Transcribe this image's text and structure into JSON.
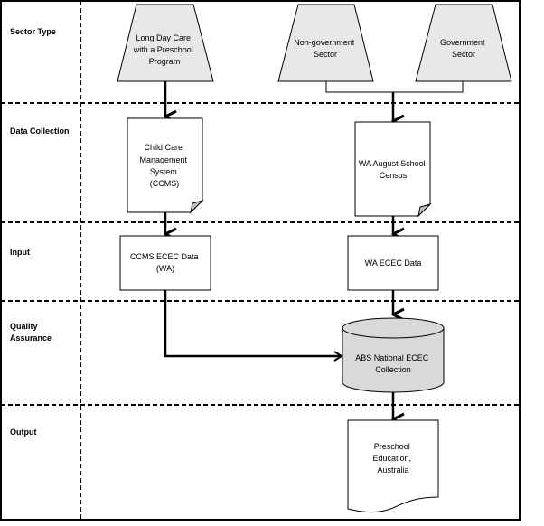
{
  "diagram": {
    "colors": {
      "shape_fill_gray": "#e8e8e8",
      "cylinder_fill": "#d9d9d9",
      "fold_fill": "#c0c0c0",
      "line": "#000000",
      "background": "#ffffff"
    },
    "lanes": [
      {
        "id": "sector-type",
        "label": [
          "Sector Type"
        ]
      },
      {
        "id": "data-collection",
        "label": [
          "Data Collection"
        ]
      },
      {
        "id": "input",
        "label": [
          "Input"
        ]
      },
      {
        "id": "quality-assurance",
        "label": [
          "Quality",
          "Assurance"
        ]
      },
      {
        "id": "output",
        "label": [
          "Output"
        ]
      }
    ],
    "nodes": {
      "long_day_care": {
        "shape": "trapezoid",
        "text": [
          "Long Day Care",
          "with a Preschool",
          "Program"
        ]
      },
      "non_government": {
        "shape": "trapezoid",
        "text": [
          "Non-government",
          "Sector"
        ]
      },
      "government": {
        "shape": "trapezoid",
        "text": [
          "Government",
          "Sector"
        ]
      },
      "ccms": {
        "shape": "document-folded",
        "text": [
          "Child Care",
          "Management",
          "System",
          "(CCMS)"
        ]
      },
      "wa_census": {
        "shape": "document-folded",
        "text": [
          "WA August School",
          "Census"
        ]
      },
      "ccms_ecec": {
        "shape": "rectangle",
        "text": [
          "CCMS ECEC Data",
          "(WA)"
        ]
      },
      "wa_ecec": {
        "shape": "rectangle",
        "text": [
          "WA ECEC Data"
        ]
      },
      "abs_national": {
        "shape": "cylinder",
        "text": [
          "ABS National ECEC",
          "Collection"
        ]
      },
      "preschool_edu": {
        "shape": "document",
        "text": [
          "Preschool",
          "Education,",
          "Australia"
        ]
      }
    },
    "edges": [
      {
        "from": "long_day_care",
        "to": "ccms"
      },
      {
        "from": "non_government",
        "to": "wa_census"
      },
      {
        "from": "government",
        "to": "wa_census"
      },
      {
        "from": "ccms",
        "to": "ccms_ecec"
      },
      {
        "from": "wa_census",
        "to": "wa_ecec"
      },
      {
        "from": "ccms_ecec",
        "to": "abs_national"
      },
      {
        "from": "wa_ecec",
        "to": "abs_national"
      },
      {
        "from": "abs_national",
        "to": "preschool_edu"
      }
    ]
  }
}
